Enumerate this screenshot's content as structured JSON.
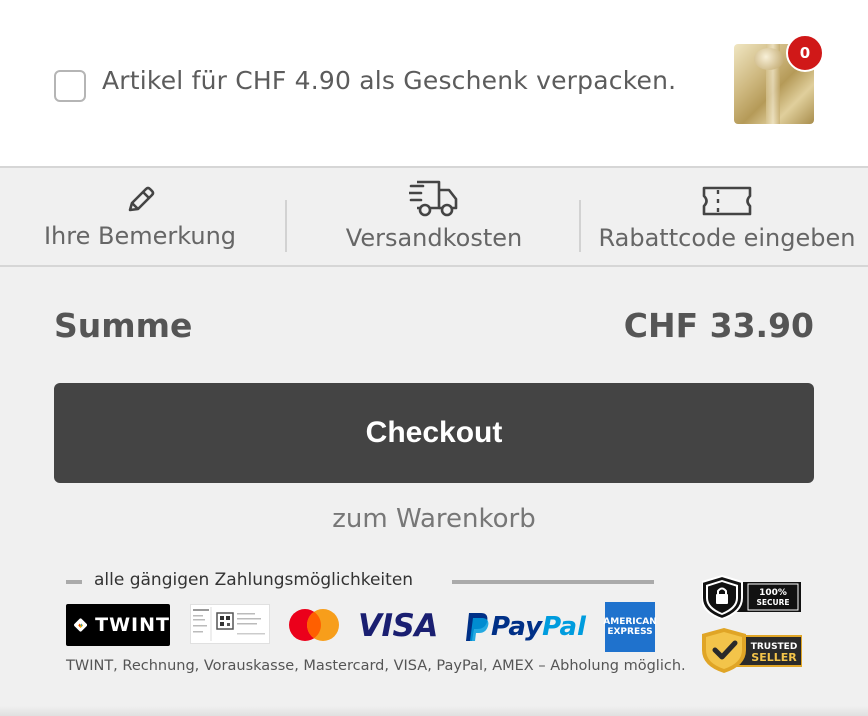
{
  "gift_wrap": {
    "label": "Artikel für CHF 4.90 als Geschenk verpacken.",
    "checked": false,
    "cart_count": "0"
  },
  "tools": {
    "remark": "Ihre Bemerkung",
    "shipping": "Versandkosten",
    "coupon": "Rabattcode eingeben"
  },
  "summary": {
    "label": "Summe",
    "value": "CHF 33.90"
  },
  "checkout": {
    "button_label": "Checkout",
    "back_link": "zum Warenkorb"
  },
  "payments": {
    "heading": "alle gängigen Zahlungsmöglichkeiten",
    "twint": "TWINT",
    "visa": "VISA",
    "paypal_pay": "Pay",
    "paypal_pal": "Pal",
    "amex_line1": "AMERICAN",
    "amex_line2": "EXPRESS",
    "note": "TWINT, Rechnung, Vorauskasse, Mastercard, VISA, PayPal, AMEX – Abholung möglich."
  },
  "trust_badges": {
    "secure_line1": "100%",
    "secure_line2": "SECURE",
    "trusted_line1": "TRUSTED",
    "trusted_line2": "SELLER"
  },
  "colors": {
    "checkout_bg": "#444444",
    "badge_red": "#d01818",
    "visa_blue": "#1a1f71",
    "paypal_dark": "#003087",
    "paypal_light": "#009cde",
    "amex_blue": "#1f72cd"
  }
}
